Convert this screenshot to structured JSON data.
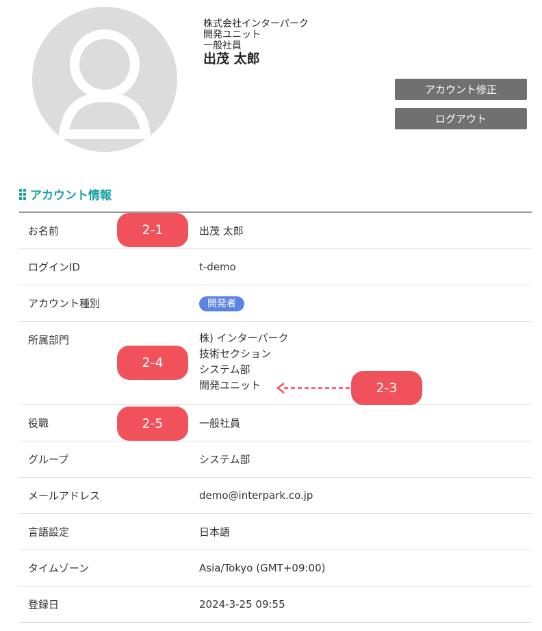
{
  "profile": {
    "company": "株式会社インターパーク",
    "unit": "開発ユニット",
    "title": "一般社員",
    "name": "出茂 太郎"
  },
  "buttons": {
    "edit": "アカウント修正",
    "logout": "ログアウト"
  },
  "section": {
    "title": "アカウント情報"
  },
  "rows": [
    {
      "label": "お名前",
      "value": "出茂 太郎"
    },
    {
      "label": "ログインID",
      "value": "t-demo"
    },
    {
      "label": "アカウント種別",
      "value": "開発者"
    },
    {
      "label": "所属部門",
      "lines": [
        "株) インターパーク",
        "技術セクション",
        "システム部",
        "開発ユニット"
      ]
    },
    {
      "label": "役職",
      "value": "一般社員"
    },
    {
      "label": "グループ",
      "value": "システム部"
    },
    {
      "label": "メールアドレス",
      "value": "demo@interpark.co.jp"
    },
    {
      "label": "言語設定",
      "value": "日本語"
    },
    {
      "label": "タイムゾーン",
      "value": "Asia/Tokyo (GMT+09:00)"
    },
    {
      "label": "登録日",
      "value": "2024-3-25 09:55"
    }
  ],
  "callouts": {
    "c1": "2-1",
    "c3": "2-3",
    "c4": "2-4",
    "c5": "2-5"
  },
  "colors": {
    "accent": "#18a2a0",
    "callout": "#f0515b",
    "badge": "#5b84e0",
    "button": "#707070"
  },
  "icons": {
    "avatar": "user-silhouette-icon",
    "section": "grip-icon",
    "arrow": "dashed-arrow-left-icon"
  }
}
